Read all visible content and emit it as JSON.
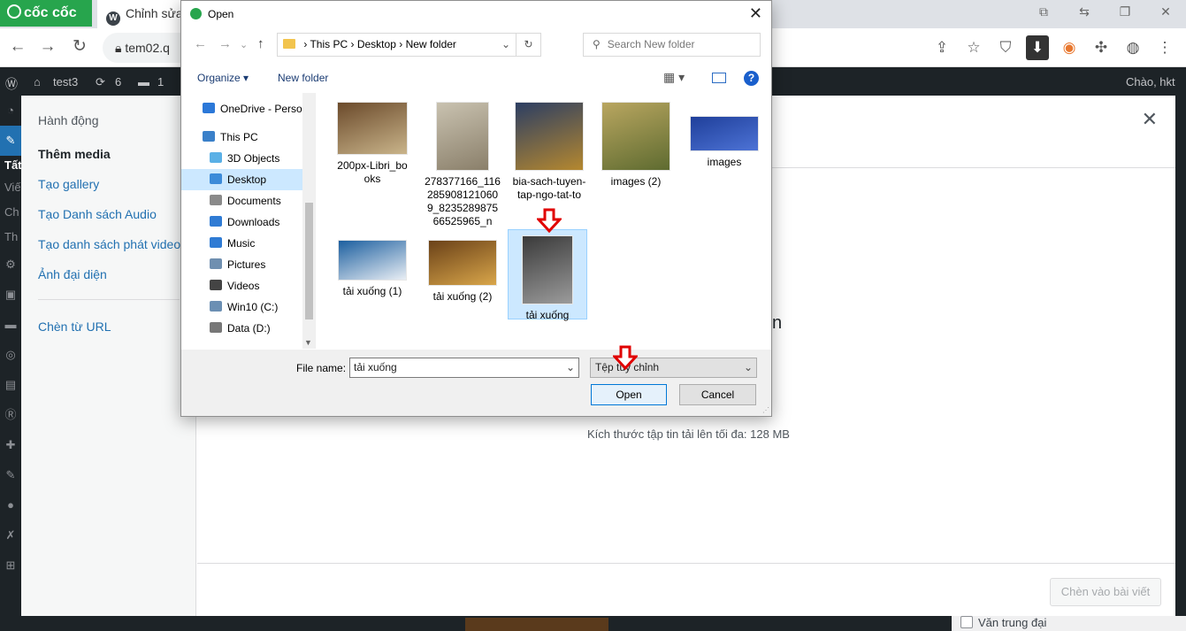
{
  "browser": {
    "brand": "cốc cốc",
    "tab_title": "Chỉnh sửa",
    "address": "tem02.q",
    "controls": [
      "⧉",
      "⇆",
      "❐",
      "✕"
    ]
  },
  "wp_admin_bar": {
    "site": "test3",
    "updates": "6",
    "comments": "1",
    "greeting": "Chào, hkt"
  },
  "wp_side_partial": [
    "Tất",
    "Viế",
    "Ch",
    "Th"
  ],
  "media_modal": {
    "menu": {
      "actions_heading": "Hành động",
      "add_media": "Thêm media",
      "create_gallery": "Tạo gallery",
      "create_audio_playlist": "Tạo Danh sách Audio",
      "create_video_playlist": "Tạo danh sách phát video",
      "featured_image": "Ảnh đại diện",
      "insert_from_url": "Chèn từ URL"
    },
    "partial_text": "n",
    "max_upload": "Kích thước tập tin tải lên tối đa: 128 MB",
    "insert_button": "Chèn vào bài viết",
    "bg_checkbox_label": "Văn trung đại"
  },
  "dialog": {
    "title": "Open",
    "breadcrumb": [
      "This PC",
      "Desktop",
      "New folder"
    ],
    "search_placeholder": "Search New folder",
    "organize": "Organize",
    "new_folder": "New folder",
    "nav_items": [
      {
        "label": "OneDrive - Persor",
        "color": "#2b78d8"
      },
      {
        "label": "This PC",
        "color": "#3a80c9"
      },
      {
        "label": "3D Objects",
        "color": "#5ab0e6"
      },
      {
        "label": "Desktop",
        "color": "#3c8bd9"
      },
      {
        "label": "Documents",
        "color": "#8a8a8a"
      },
      {
        "label": "Downloads",
        "color": "#2f7bd4"
      },
      {
        "label": "Music",
        "color": "#2f7bd4"
      },
      {
        "label": "Pictures",
        "color": "#6f8fb0"
      },
      {
        "label": "Videos",
        "color": "#444444"
      },
      {
        "label": "Win10 (C:)",
        "color": "#6b8fb3"
      },
      {
        "label": "Data (D:)",
        "color": "#777777"
      }
    ],
    "files": [
      {
        "name": "200px-Libri_books",
        "colors": [
          "#6b4a2b",
          "#c9b48a"
        ]
      },
      {
        "name": "278377166_1162859081210609_823528987566525965_n",
        "colors": [
          "#c9c2b0",
          "#8a7f6a"
        ]
      },
      {
        "name": "bia-sach-tuyen-tap-ngo-tat-to",
        "colors": [
          "#2c3e63",
          "#b5882f"
        ]
      },
      {
        "name": "images (2)",
        "colors": [
          "#b9a660",
          "#5e6b30"
        ]
      },
      {
        "name": "images",
        "colors": [
          "#1f3f9a",
          "#4d73d6"
        ]
      },
      {
        "name": "tải xuống (1)",
        "colors": [
          "#1c5f9f",
          "#e9eef4"
        ]
      },
      {
        "name": "tải xuống (2)",
        "colors": [
          "#6a4118",
          "#d9a64a"
        ]
      },
      {
        "name": "tải xuống",
        "colors": [
          "#3a3a3a",
          "#9b9b9b"
        ]
      }
    ],
    "file_name_label": "File name:",
    "file_name_value": "tải xuống",
    "file_type": "Tệp tùy chỉnh",
    "open_button": "Open",
    "cancel_button": "Cancel"
  },
  "colors": {
    "wp_dark": "#1d2327",
    "wp_blue": "#2271b1",
    "cococ_green": "#27a54d",
    "selection_blue": "#cce8ff",
    "annotation_red": "#e00000"
  }
}
